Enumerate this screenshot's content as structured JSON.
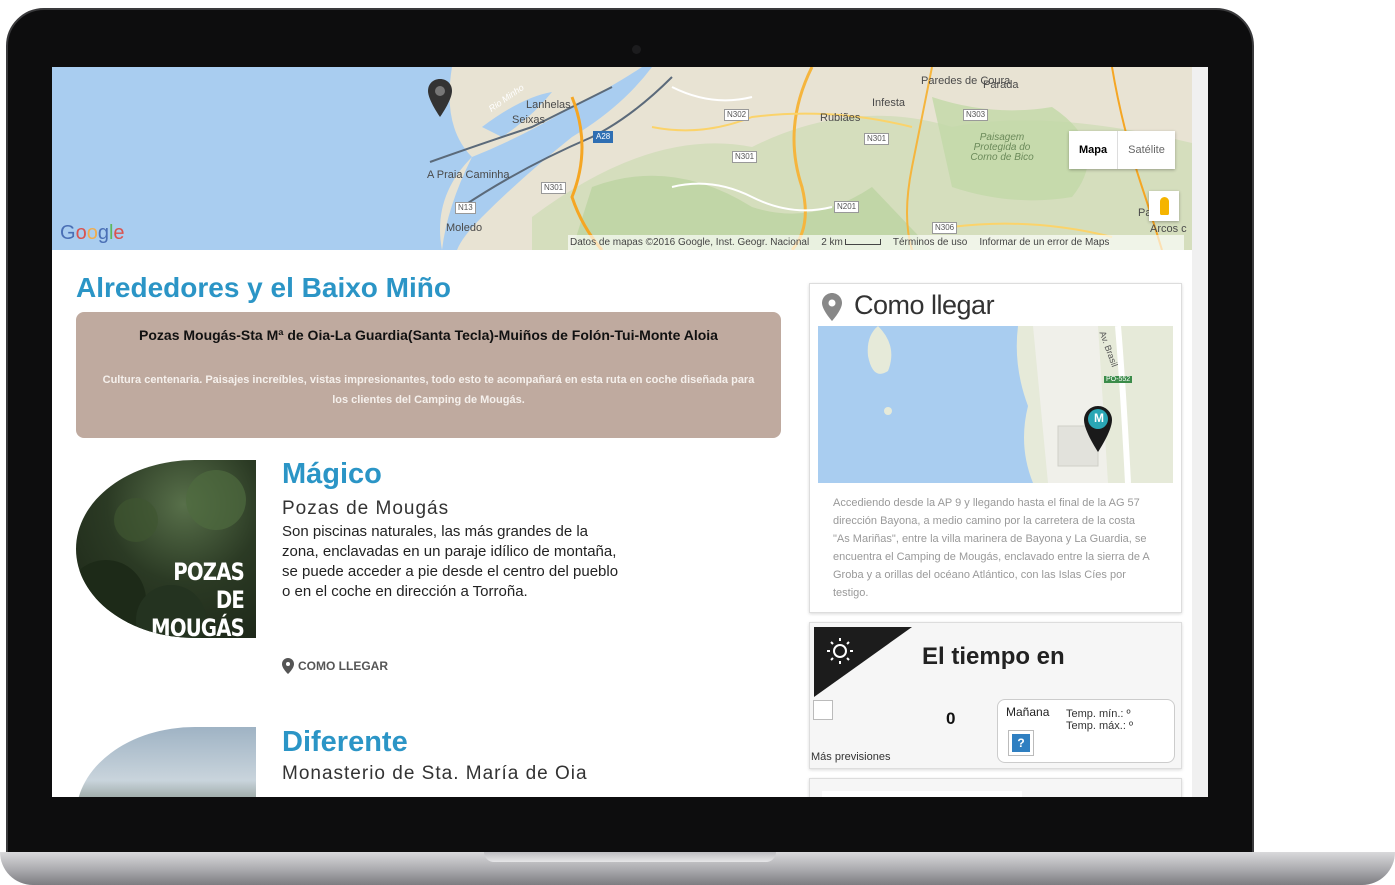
{
  "map": {
    "places": [
      "Paredes de Coura",
      "Parada",
      "Infesta",
      "Rubiães",
      "Lanhelas",
      "Seixas",
      "A Praia Caminha",
      "Moledo",
      "Rio Minho",
      "Arcos c",
      "Pa"
    ],
    "park_label": "Paisagem Protegida do Corno de Bico",
    "roads": [
      "N302",
      "N303",
      "N301",
      "N301",
      "N301",
      "A28",
      "N13",
      "N201",
      "N306"
    ],
    "type_map": "Mapa",
    "type_satellite": "Satélite",
    "logo": "Google",
    "attribution": "Datos de mapas ©2016 Google, Inst. Geogr. Nacional",
    "scale": "2 km",
    "terms": "Términos de uso",
    "report": "Informar de un error de Maps"
  },
  "page": {
    "title": "Alrededores y el Baixo Miño",
    "intro_title": "Pozas Mougás-Sta Mª de Oia-La Guardia(Santa Tecla)-Muiños de Folón-Tui-Monte Aloia",
    "intro_text": "Cultura centenaria. Paisajes increíbles, vistas impresionantes, todo esto te acompañará en esta ruta en coche diseñada para los clientes del Camping de Mougás."
  },
  "attractions": [
    {
      "image_caption": "POZAS DE MOUGÁS",
      "heading": "Mágico",
      "subtitle": "Pozas de Mougás",
      "description": "Son piscinas naturales, las más grandes de la zona, enclavadas en un paraje idílico de montaña, se puede acceder a pie desde el centro del pueblo o en el coche en dirección a Torroña.",
      "link": "COMO LLEGAR"
    },
    {
      "heading": "Diferente",
      "subtitle": "Monasterio de Sta. María de Oia"
    }
  ],
  "directions": {
    "title": "Como llegar",
    "map_road_label": "Av. Brasil",
    "map_road_badge": "PO-552",
    "map_marker_letter": "M",
    "text": "Accediendo desde la AP 9 y llegando hasta el final de la AG 57 dirección Bayona, a medio camino por la carretera de la costa \"As Mariñas\", entre la villa marinera de Bayona y La Guardia, se encuentra el Camping de Mougás, enclavado entre la sierra de A Groba y a orillas del océano Atlántico, con las Islas Cíes por testigo."
  },
  "weather": {
    "title": "El tiempo en",
    "temp": "0",
    "more": "Más previsiones",
    "day": "Mañana",
    "unknown_icon": "?",
    "temp_min": "Temp. mín.: º",
    "temp_max": "Temp. máx.: º"
  },
  "colors": {
    "accent": "#2b95c6",
    "intro_box": "#bfaa9f",
    "marker_teal": "#2aa7b5"
  }
}
